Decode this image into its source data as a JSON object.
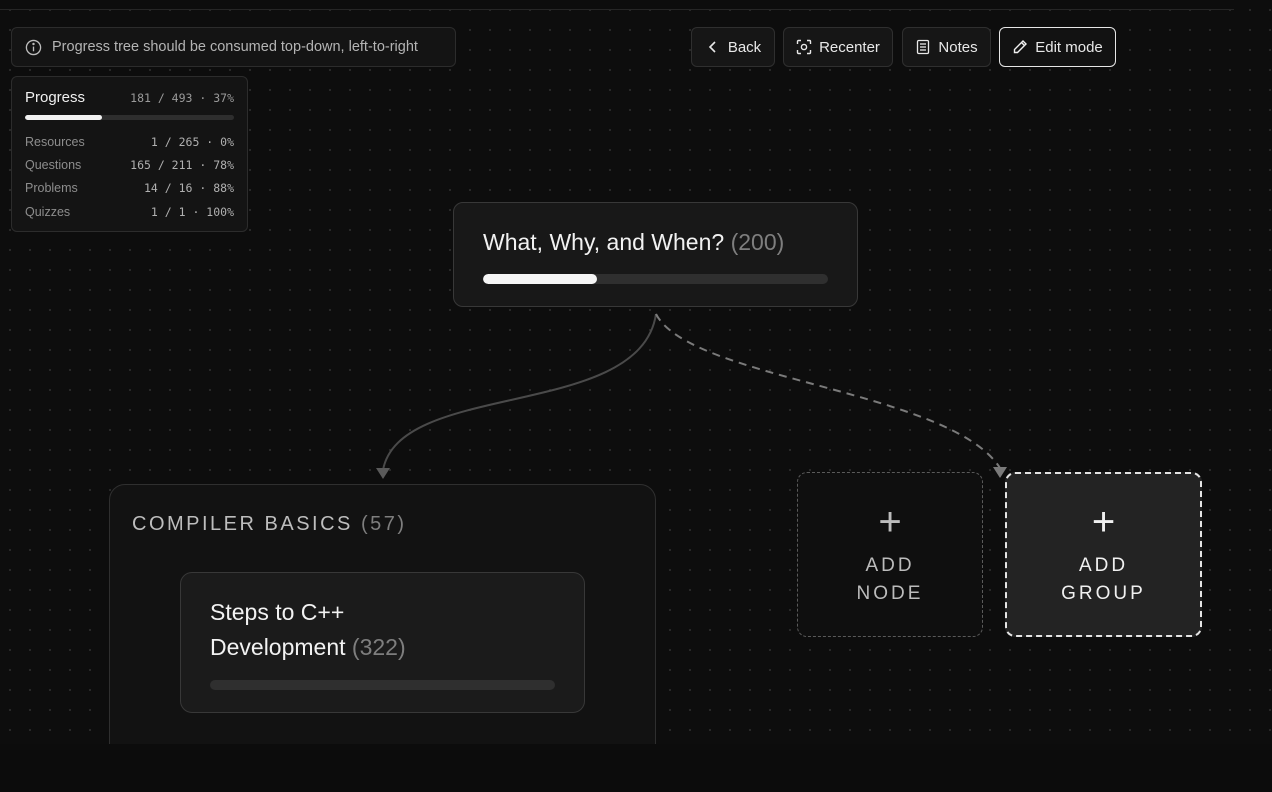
{
  "info_banner": {
    "text": "Progress tree should be consumed top-down, left-to-right",
    "icon": "info-circle-icon"
  },
  "toolbar": {
    "back_label": "Back",
    "recenter_label": "Recenter",
    "notes_label": "Notes",
    "edit_mode_label": "Edit mode",
    "edit_mode_active": true
  },
  "progress": {
    "title": "Progress",
    "summary": "181 / 493 · 37%",
    "fraction": 0.37,
    "rows": [
      {
        "label": "Resources",
        "value": "1 / 265 · 0%"
      },
      {
        "label": "Questions",
        "value": "165 / 211 · 78%"
      },
      {
        "label": "Problems",
        "value": "14 / 16 · 88%"
      },
      {
        "label": "Quizzes",
        "value": "1 / 1 · 100%"
      }
    ]
  },
  "nodes": {
    "root": {
      "title": "What, Why, and When?",
      "count": "(200)",
      "progress": 0.33
    },
    "child": {
      "title": "Steps to C++ Development",
      "count": "(322)",
      "progress": 0.0
    }
  },
  "group": {
    "title": "COMPILER BASICS",
    "count": "(57)"
  },
  "add_node": {
    "plus": "+",
    "label": "ADD NODE"
  },
  "add_group": {
    "plus": "+",
    "label": "ADD GROUP"
  },
  "colors": {
    "background": "#0d0d0d",
    "accent": "#f5f5f5",
    "border": "#383838"
  }
}
